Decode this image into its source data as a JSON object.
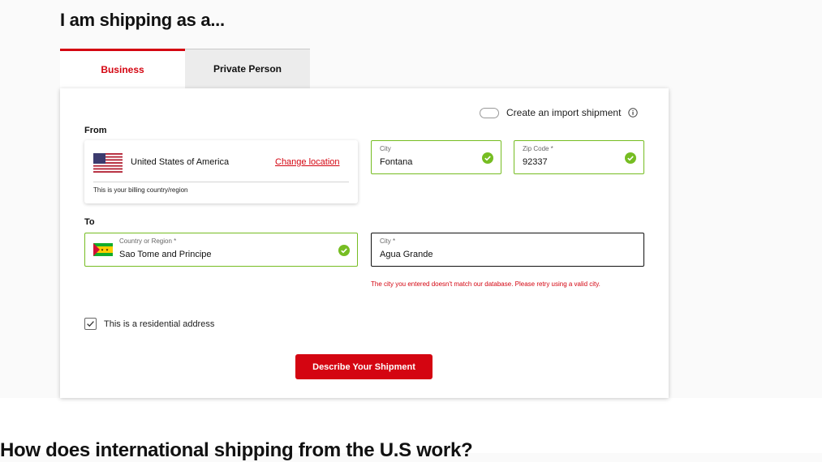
{
  "header": {
    "title": "I am shipping as a..."
  },
  "tabs": [
    {
      "label": "Business",
      "active": true
    },
    {
      "label": "Private Person",
      "active": false
    }
  ],
  "import_toggle": {
    "label": "Create an import shipment",
    "icon": "info-icon",
    "on": false
  },
  "from": {
    "label": "From",
    "country": "United States of America",
    "flag": "us-flag",
    "change_link": "Change location",
    "billing_note": "This is your billing country/region",
    "city": {
      "label": "City",
      "value": "Fontana",
      "status": "valid"
    },
    "zip": {
      "label": "Zip Code *",
      "value": "92337",
      "status": "valid"
    }
  },
  "to": {
    "label": "To",
    "country": {
      "label": "Country or Region *",
      "value": "Sao Tome and Principe",
      "flag": "sao-tome-flag",
      "status": "valid"
    },
    "city": {
      "label": "City *",
      "value": "Agua Grande",
      "status": "error"
    },
    "error_message": "The city you entered doesn't match our database. Please retry using a valid city."
  },
  "residential": {
    "label": "This is a residential address",
    "checked": true
  },
  "submit": {
    "label": "Describe Your Shipment"
  },
  "next_section": {
    "heading": "How does international shipping from the U.S work?"
  },
  "colors": {
    "brand_red": "#d40511",
    "valid_green": "#76bd22"
  }
}
